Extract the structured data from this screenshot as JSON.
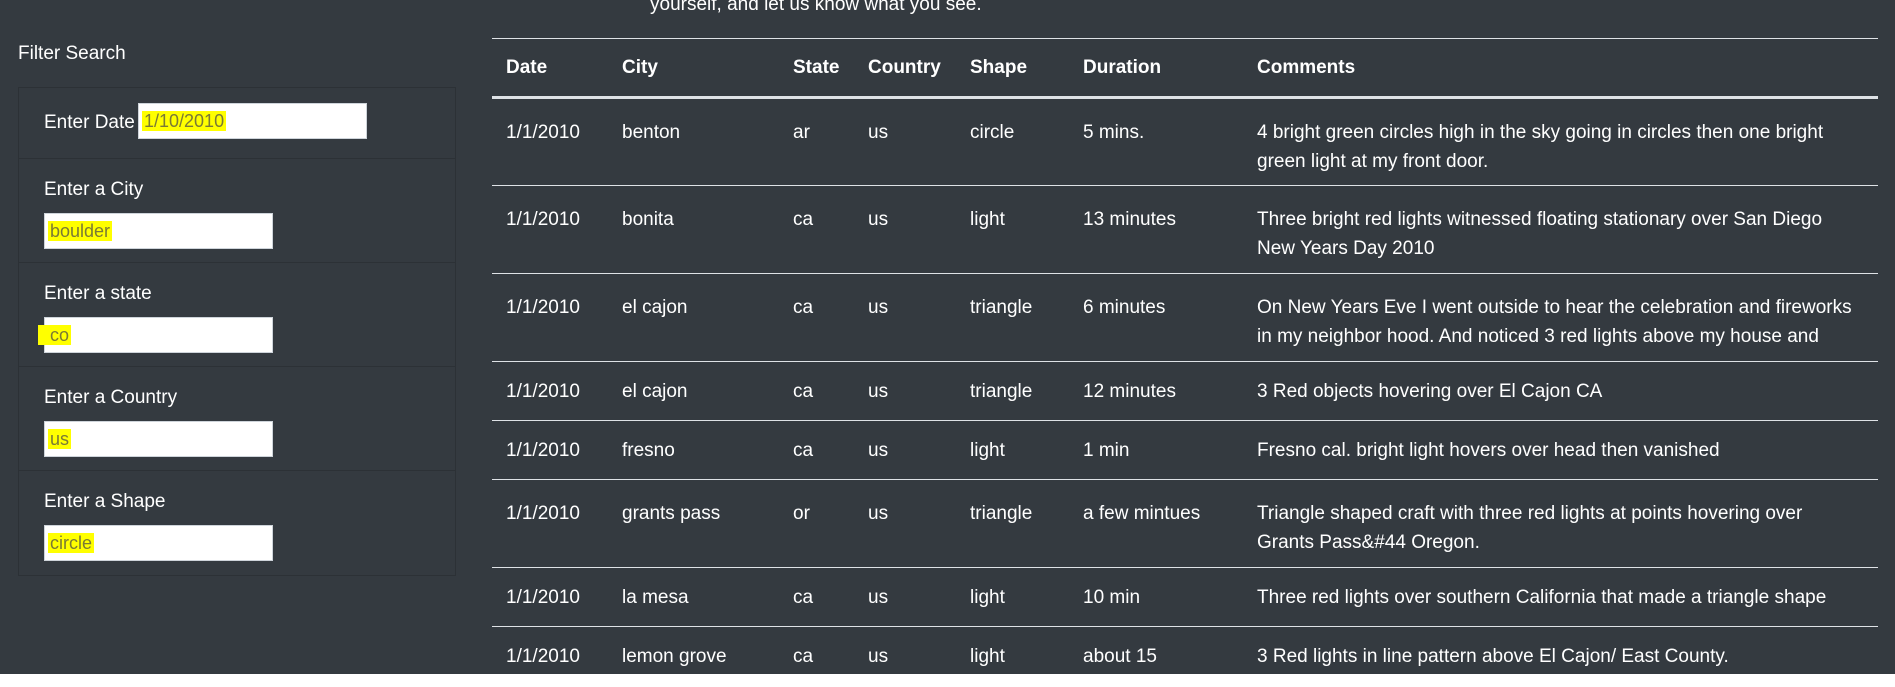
{
  "intro_text": "yourself, and let us know what you see.",
  "filter": {
    "title": "Filter Search",
    "fields": {
      "date": {
        "label": "Enter Date",
        "value": "1/10/2010"
      },
      "city": {
        "label": "Enter a City",
        "value": "boulder"
      },
      "state": {
        "label": "Enter a state",
        "value": "co"
      },
      "country": {
        "label": "Enter a Country",
        "value": "us"
      },
      "shape": {
        "label": "Enter a Shape",
        "value": "circle"
      }
    }
  },
  "table": {
    "headers": [
      "Date",
      "City",
      "State",
      "Country",
      "Shape",
      "Duration",
      "Comments"
    ],
    "rows": [
      [
        "1/1/2010",
        "benton",
        "ar",
        "us",
        "circle",
        "5 mins.",
        "4 bright green circles high in the sky going in circles then one bright green light at my front door."
      ],
      [
        "1/1/2010",
        "bonita",
        "ca",
        "us",
        "light",
        "13 minutes",
        "Three bright red lights witnessed floating stationary over San Diego New Years Day 2010"
      ],
      [
        "1/1/2010",
        "el cajon",
        "ca",
        "us",
        "triangle",
        "6 minutes",
        "On New Years Eve I went outside to hear the celebration and fireworks in my neighbor hood. And noticed 3 red lights above my house and"
      ],
      [
        "1/1/2010",
        "el cajon",
        "ca",
        "us",
        "triangle",
        "12 minutes",
        "3 Red objects hovering over El Cajon CA"
      ],
      [
        "1/1/2010",
        "fresno",
        "ca",
        "us",
        "light",
        "1 min",
        "Fresno cal. bright light hovers over head then vanished"
      ],
      [
        "1/1/2010",
        "grants pass",
        "or",
        "us",
        "triangle",
        "a few mintues",
        "Triangle shaped craft with three red lights at points hovering over Grants Pass&#44 Oregon."
      ],
      [
        "1/1/2010",
        "la mesa",
        "ca",
        "us",
        "light",
        "10 min",
        "Three red lights over southern California that made a triangle shape"
      ],
      [
        "1/1/2010",
        "lemon grove",
        "ca",
        "us",
        "light",
        "about 15",
        "3 Red lights in line pattern above El Cajon/ East County."
      ]
    ]
  },
  "colors": {
    "background": "#343a40",
    "highlight": "#ffff00",
    "text": "#ffffff"
  }
}
